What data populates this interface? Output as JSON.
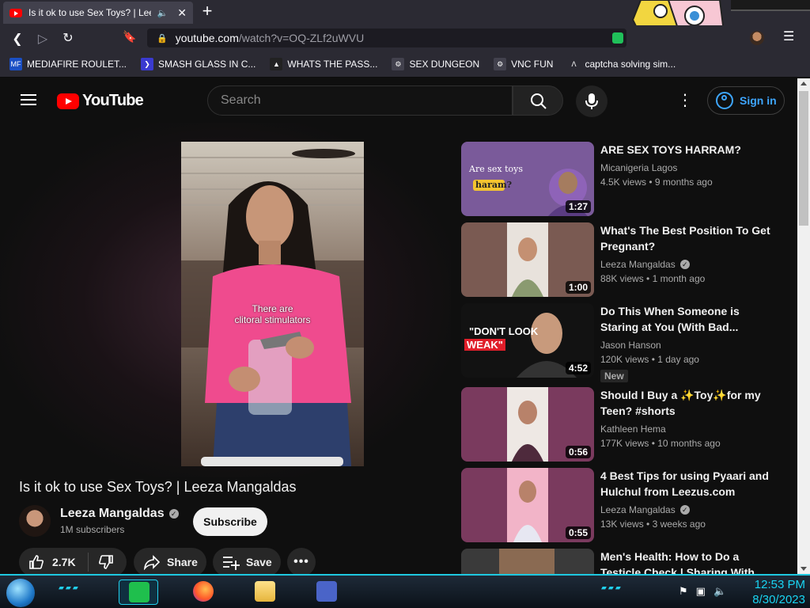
{
  "browser": {
    "tab_title": "Is it ok to use Sex Toys? | Leez",
    "tab_audio_icon": "speaker-icon",
    "new_tab_label": "+",
    "url_host": "youtube.com",
    "url_path": "/watch?v=OQ-ZLf2uWVU",
    "bookmarks": [
      {
        "label": "MEDIAFIRE ROULET...",
        "icon": "mediafire-icon",
        "color": "#1a4fc4",
        "glyph": "MF"
      },
      {
        "label": "SMASH GLASS IN C...",
        "icon": "chevron-bookmark-icon",
        "color": "#3a3ad0",
        "glyph": "❯"
      },
      {
        "label": "WHATS THE PASS...",
        "icon": "lock-bookmark-icon",
        "color": "#222222",
        "glyph": "▲"
      },
      {
        "label": "SEX DUNGEON",
        "icon": "gear-bookmark-icon",
        "color": "#42414d",
        "glyph": "⚙"
      },
      {
        "label": "VNC FUN",
        "icon": "gear-bookmark-icon",
        "color": "#42414d",
        "glyph": "⚙"
      },
      {
        "label": "captcha solving sim...",
        "icon": "a-bookmark-icon",
        "color": "#2b2a33",
        "glyph": "Λ"
      }
    ]
  },
  "youtube": {
    "logo_text": "YouTube",
    "search_placeholder": "Search",
    "sign_in_label": "Sign in",
    "video": {
      "caption_line1": "There are",
      "caption_line2": "clitoral stimulators",
      "title": "Is it ok to use Sex Toys? | Leeza Mangaldas",
      "channel": "Leeza Mangaldas",
      "verified_glyph": "✓",
      "subscribers": "1M subscribers",
      "subscribe_label": "Subscribe",
      "likes": "2.7K",
      "share_label": "Share",
      "save_label": "Save",
      "more_label": "•••"
    },
    "recommendations": [
      {
        "title": "ARE SEX TOYS HARRAM?",
        "channel": "Micanigeria Lagos",
        "verified": false,
        "views": "4.5K views",
        "age": "9 months ago",
        "duration": "1:27",
        "badge": "",
        "thumb_text1": "Are sex toys",
        "thumb_text2": "haram?"
      },
      {
        "title": "What's The Best Position To Get Pregnant?",
        "channel": "Leeza Mangaldas",
        "verified": true,
        "views": "88K views",
        "age": "1 month ago",
        "duration": "1:00",
        "badge": ""
      },
      {
        "title": "Do This When Someone is Staring at You (With Bad...",
        "channel": "Jason Hanson",
        "verified": false,
        "views": "120K views",
        "age": "1 day ago",
        "duration": "4:52",
        "badge": "New",
        "thumb_text1": "\"DON'T LOOK",
        "thumb_text2": "WEAK\""
      },
      {
        "title": "Should I Buy a ✨Toy✨for my Teen? #shorts",
        "channel": "Kathleen Hema",
        "verified": false,
        "views": "177K views",
        "age": "10 months ago",
        "duration": "0:56",
        "badge": ""
      },
      {
        "title": "4 Best Tips for using Pyaari and Hulchul from Leezus.com",
        "channel": "Leeza Mangaldas",
        "verified": true,
        "views": "13K views",
        "age": "3 weeks ago",
        "duration": "0:55",
        "badge": ""
      },
      {
        "title": "Men's Health: How to Do a Testicle Check | Sharing With",
        "channel": "",
        "verified": false,
        "views": "",
        "age": "",
        "duration": "",
        "badge": ""
      }
    ]
  },
  "taskbar": {
    "time": "12:53 PM",
    "date": "8/30/2023"
  },
  "colors": {
    "accent_blue": "#3ea6ff",
    "youtube_red": "#ff0000",
    "taskbar_cyan": "#21d0ee"
  }
}
